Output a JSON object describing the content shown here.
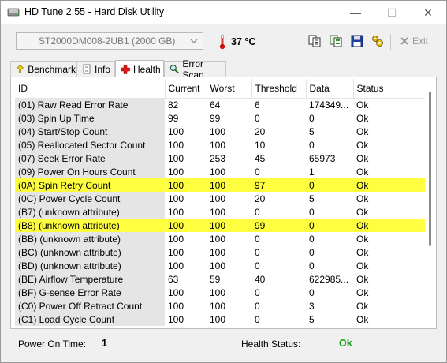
{
  "window": {
    "title": "HD Tune 2.55 - Hard Disk Utility"
  },
  "window_controls": {
    "minimize": "—",
    "maximize": "☐",
    "close": "✕"
  },
  "toolbar": {
    "drive": "ST2000DM008-2UB1 (2000 GB)",
    "temperature": "37 °C",
    "exit_label": "Exit"
  },
  "tabs": [
    {
      "label": "Benchmark",
      "icon": "benchmark-icon",
      "active": false
    },
    {
      "label": "Info",
      "icon": "info-icon",
      "active": false
    },
    {
      "label": "Health",
      "icon": "health-cross-icon",
      "active": true
    },
    {
      "label": "Error Scan",
      "icon": "error-scan-icon",
      "active": false
    }
  ],
  "table": {
    "columns": [
      "ID",
      "Current",
      "Worst",
      "Threshold",
      "Data",
      "Status"
    ],
    "rows": [
      {
        "id": "(01) Raw Read Error Rate",
        "current": "82",
        "worst": "64",
        "threshold": "6",
        "data": "174349...",
        "status": "Ok",
        "highlight": false
      },
      {
        "id": "(03) Spin Up Time",
        "current": "99",
        "worst": "99",
        "threshold": "0",
        "data": "0",
        "status": "Ok",
        "highlight": false
      },
      {
        "id": "(04) Start/Stop Count",
        "current": "100",
        "worst": "100",
        "threshold": "20",
        "data": "5",
        "status": "Ok",
        "highlight": false
      },
      {
        "id": "(05) Reallocated Sector Count",
        "current": "100",
        "worst": "100",
        "threshold": "10",
        "data": "0",
        "status": "Ok",
        "highlight": false
      },
      {
        "id": "(07) Seek Error Rate",
        "current": "100",
        "worst": "253",
        "threshold": "45",
        "data": "65973",
        "status": "Ok",
        "highlight": false
      },
      {
        "id": "(09) Power On Hours Count",
        "current": "100",
        "worst": "100",
        "threshold": "0",
        "data": "1",
        "status": "Ok",
        "highlight": false
      },
      {
        "id": "(0A) Spin Retry Count",
        "current": "100",
        "worst": "100",
        "threshold": "97",
        "data": "0",
        "status": "Ok",
        "highlight": true
      },
      {
        "id": "(0C) Power Cycle Count",
        "current": "100",
        "worst": "100",
        "threshold": "20",
        "data": "5",
        "status": "Ok",
        "highlight": false
      },
      {
        "id": "(B7) (unknown attribute)",
        "current": "100",
        "worst": "100",
        "threshold": "0",
        "data": "0",
        "status": "Ok",
        "highlight": false
      },
      {
        "id": "(B8) (unknown attribute)",
        "current": "100",
        "worst": "100",
        "threshold": "99",
        "data": "0",
        "status": "Ok",
        "highlight": true
      },
      {
        "id": "(BB) (unknown attribute)",
        "current": "100",
        "worst": "100",
        "threshold": "0",
        "data": "0",
        "status": "Ok",
        "highlight": false
      },
      {
        "id": "(BC) (unknown attribute)",
        "current": "100",
        "worst": "100",
        "threshold": "0",
        "data": "0",
        "status": "Ok",
        "highlight": false
      },
      {
        "id": "(BD) (unknown attribute)",
        "current": "100",
        "worst": "100",
        "threshold": "0",
        "data": "0",
        "status": "Ok",
        "highlight": false
      },
      {
        "id": "(BE) Airflow Temperature",
        "current": "63",
        "worst": "59",
        "threshold": "40",
        "data": "622985...",
        "status": "Ok",
        "highlight": false
      },
      {
        "id": "(BF) G-sense Error Rate",
        "current": "100",
        "worst": "100",
        "threshold": "0",
        "data": "0",
        "status": "Ok",
        "highlight": false
      },
      {
        "id": "(C0) Power Off Retract Count",
        "current": "100",
        "worst": "100",
        "threshold": "0",
        "data": "3",
        "status": "Ok",
        "highlight": false
      },
      {
        "id": "(C1) Load Cycle Count",
        "current": "100",
        "worst": "100",
        "threshold": "0",
        "data": "5",
        "status": "Ok",
        "highlight": false
      }
    ]
  },
  "status_bar": {
    "power_on_label": "Power On Time:",
    "power_on_value": "1",
    "health_label": "Health Status:",
    "health_value": "Ok"
  },
  "colors": {
    "highlight_row": "#ffff40",
    "health_ok": "#1aa31a",
    "id_column_bg": "#e5e5e5",
    "temperature_icon": "#d01010"
  }
}
